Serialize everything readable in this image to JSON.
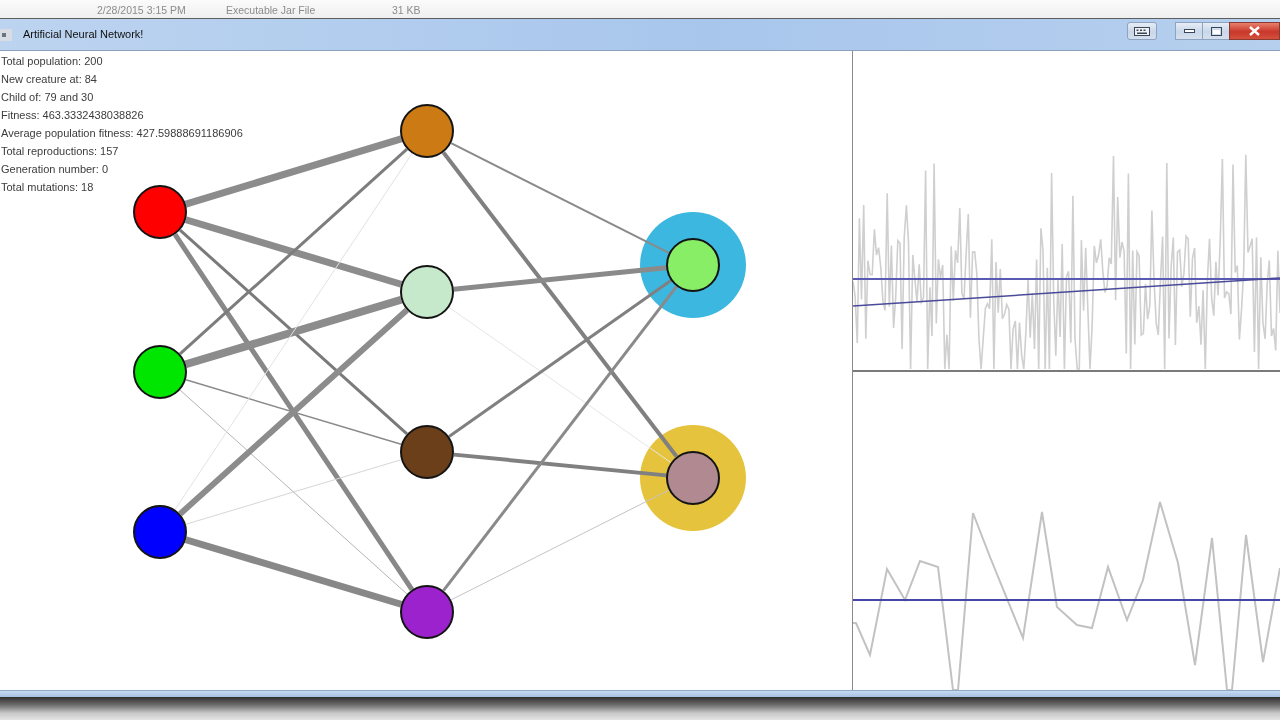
{
  "background_window": {
    "file_row": [
      "2/28/2015 3:15 PM",
      "Executable Jar File",
      "31 KB"
    ]
  },
  "window": {
    "title": "Artificial Neural Network!"
  },
  "stats": [
    "Total population: 200",
    "New creature at: 84",
    "Child of: 79 and 30",
    "Fitness: 463.3332438038826",
    "Average population fitness: 427.59888691186906",
    "Total reproductions: 157",
    "Generation number: 0",
    "Total mutations: 18"
  ],
  "network": {
    "layers": [
      {
        "nodes": [
          {
            "color": "#ff0000"
          },
          {
            "color": "#00e600"
          },
          {
            "color": "#0000ff"
          }
        ]
      },
      {
        "nodes": [
          {
            "color": "#cc7a14"
          },
          {
            "color": "#c6e9cc"
          },
          {
            "color": "#6b3f1a"
          },
          {
            "color": "#9b22cc"
          }
        ]
      },
      {
        "nodes": [
          {
            "color": "#88ee66",
            "highlight": {
              "color": "#3cb8e0"
            }
          },
          {
            "color": "#b08a90",
            "highlight": {
              "color": "#e6c33c"
            }
          }
        ]
      }
    ]
  }
}
